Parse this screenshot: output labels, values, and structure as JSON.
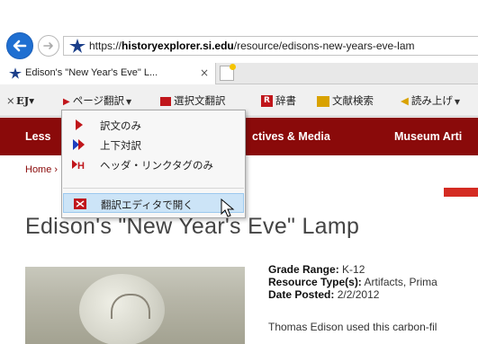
{
  "browser": {
    "url_prefix": "https://",
    "url_domain": "historyexplorer.si.edu",
    "url_path": "/resource/edisons-new-years-eve-lam",
    "tab_title": "Edison's \"New Year's Eve\" L...",
    "tab_close": "×"
  },
  "toolbar": {
    "close": "×",
    "ej_label": "EJ▾",
    "page_translate": "ページ翻訳",
    "selection_translate": "選択文翻訳",
    "dictionary": "辞書",
    "literature_search": "文献検索",
    "read_aloud": "読み上げ"
  },
  "menu": {
    "items": [
      {
        "label": "訳文のみ",
        "icon": "single-arrow-icon"
      },
      {
        "label": "上下対訳",
        "icon": "double-arrow-icon"
      },
      {
        "label": "ヘッダ・リンクタグのみ",
        "icon": "header-link-icon"
      },
      {
        "label": "翻訳エディタで開く",
        "icon": "editor-icon"
      }
    ],
    "highlighted_index": 3
  },
  "page": {
    "nav": [
      "Less",
      "ctives & Media",
      "Museum Arti"
    ],
    "breadcrumb": "Home ›",
    "title": "Edison's \"New Year's Eve\" Lamp",
    "grade_label": "Grade Range:",
    "grade_value": "K-12",
    "resource_label": "Resource Type(s):",
    "resource_value": "Artifacts, Prima",
    "date_label": "Date Posted:",
    "date_value": "2/2/2012",
    "description": "Thomas Edison used this carbon-fil"
  },
  "colors": {
    "nav_bg": "#8a0a0a",
    "accent_red": "#c0161b",
    "menu_highlight": "#cce4f7",
    "back_button": "#1f6fd1"
  }
}
